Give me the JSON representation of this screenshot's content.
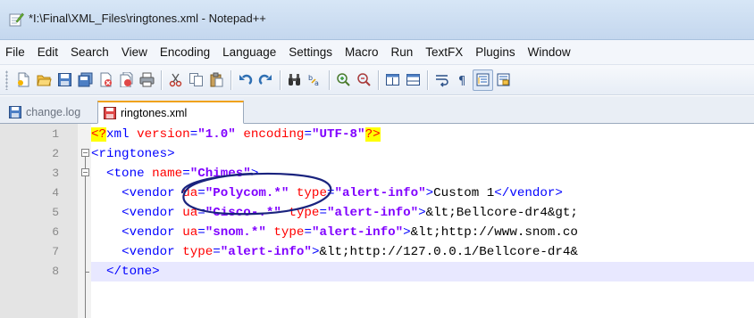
{
  "window": {
    "title": "*I:\\Final\\XML_Files\\ringtones.xml - Notepad++"
  },
  "menu": [
    "File",
    "Edit",
    "Search",
    "View",
    "Encoding",
    "Language",
    "Settings",
    "Macro",
    "Run",
    "TextFX",
    "Plugins",
    "Window"
  ],
  "toolbar": {
    "buttons": [
      "new-file",
      "open-file",
      "save",
      "save-all",
      "close",
      "close-all",
      "print",
      "cut",
      "copy",
      "paste",
      "undo",
      "redo",
      "find",
      "replace",
      "zoom-in",
      "zoom-out",
      "sync-vertical",
      "sync-horizontal",
      "word-wrap",
      "show-all-chars",
      "indent-guide",
      "user-define"
    ]
  },
  "tabs": [
    {
      "label": "change.log",
      "active": false
    },
    {
      "label": "ringtones.xml",
      "active": true
    }
  ],
  "editor": {
    "lines": [
      {
        "num": "1",
        "text": "<?xml version=\"1.0\" encoding=\"UTF-8\"?>"
      },
      {
        "num": "2",
        "text": "<ringtones>"
      },
      {
        "num": "3",
        "text": "  <tone name=\"Chimes\">"
      },
      {
        "num": "4",
        "text": "    <vendor ua=\"Polycom.*\" type=\"alert-info\">Custom 1</vendor>"
      },
      {
        "num": "5",
        "text": "    <vendor ua=\"Cisco-.*\" type=\"alert-info\">&lt;Bellcore-dr4&gt;"
      },
      {
        "num": "6",
        "text": "    <vendor ua=\"snom.*\" type=\"alert-info\">&lt;http://www.snom.co"
      },
      {
        "num": "7",
        "text": "    <vendor type=\"alert-info\">&lt;http://127.0.0.1/Bellcore-dr4&"
      },
      {
        "num": "8",
        "text": "  </tone>"
      }
    ]
  },
  "colors": {
    "tag": "#0000ff",
    "attribute": "#ff0000",
    "value": "#8000ff",
    "annotation": "#1a237e"
  }
}
